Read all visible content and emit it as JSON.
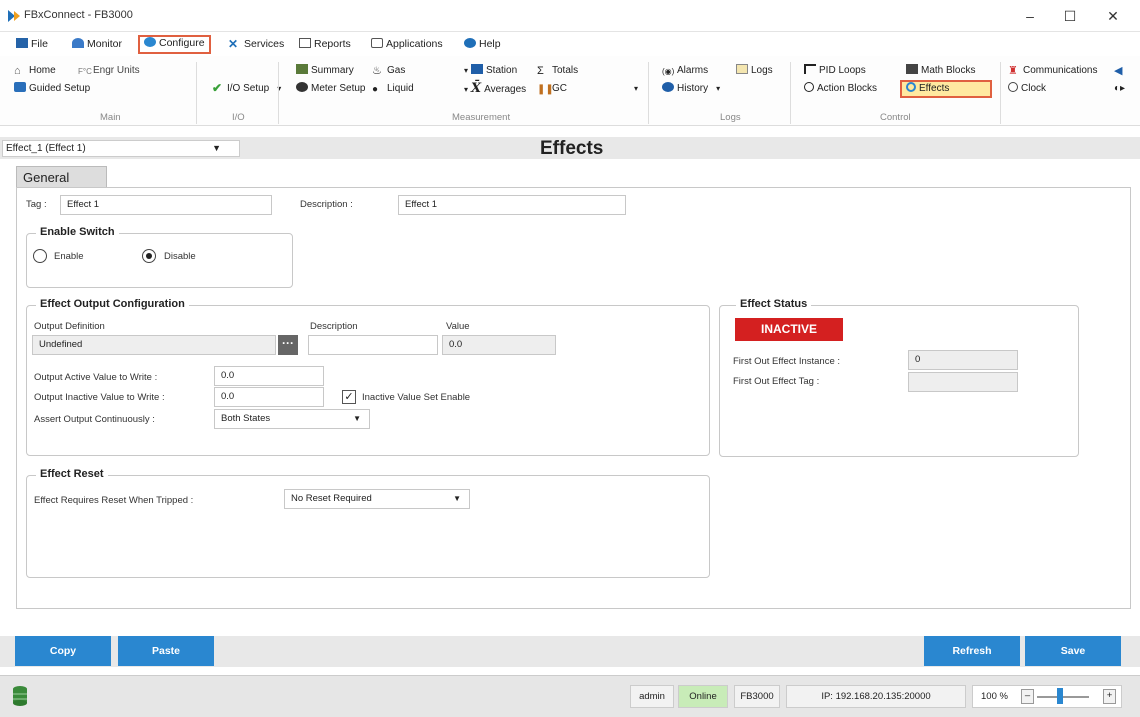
{
  "window": {
    "title": "FBxConnect - FB3000",
    "minimize": "–",
    "maximize": "☐",
    "close": "✕"
  },
  "menu": {
    "items": [
      {
        "label": "File"
      },
      {
        "label": "Monitor"
      },
      {
        "label": "Configure"
      },
      {
        "label": "Services"
      },
      {
        "label": "Reports"
      },
      {
        "label": "Applications"
      },
      {
        "label": "Help"
      }
    ]
  },
  "ribbon": {
    "home": "Home",
    "engr_units": "Engr Units",
    "guided_setup": "Guided Setup",
    "io_setup": "I/O Setup",
    "summary": "Summary",
    "meter_setup": "Meter Setup",
    "gas": "Gas",
    "liquid": "Liquid",
    "station": "Station",
    "averages": "Averages",
    "totals": "Totals",
    "gc": "GC",
    "alarms": "Alarms",
    "history": "History",
    "logs": "Logs",
    "pid_loops": "PID Loops",
    "action_blocks": "Action Blocks",
    "math_blocks": "Math Blocks",
    "effects": "Effects",
    "communications": "Communications",
    "clock": "Clock",
    "groups": {
      "main": "Main",
      "io": "I/O",
      "measurement": "Measurement",
      "logs": "Logs",
      "control": "Control"
    }
  },
  "selector": {
    "value": "Effect_1 (Effect 1)"
  },
  "page_title": "Effects",
  "tab": {
    "label": "General"
  },
  "general": {
    "tag_label": "Tag :",
    "tag_value": "Effect 1",
    "description_label": "Description :",
    "description_value": "Effect 1"
  },
  "enable_switch": {
    "legend": "Enable Switch",
    "enable": "Enable",
    "disable": "Disable",
    "selected": "Disable"
  },
  "output_config": {
    "legend": "Effect Output Configuration",
    "col_definition": "Output Definition",
    "col_description": "Description",
    "col_value": "Value",
    "definition_value": "Undefined",
    "dots": "···",
    "description_value": "",
    "value_value": "0.0",
    "active_label": "Output Active Value to Write :",
    "active_value": "0.0",
    "inactive_label": "Output Inactive Value to Write :",
    "inactive_value": "0.0",
    "inactive_set_label": "Inactive Value Set Enable",
    "inactive_set_checked": "✓",
    "assert_label": "Assert Output Continuously :",
    "assert_value": "Both States"
  },
  "effect_status": {
    "legend": "Effect Status",
    "state": "INACTIVE",
    "state_color": "#d42020",
    "instance_label": "First Out Effect Instance :",
    "instance_value": "0",
    "tag_label": "First Out Effect Tag :",
    "tag_value": ""
  },
  "effect_reset": {
    "legend": "Effect Reset",
    "label": "Effect Requires Reset When Tripped :",
    "value": "No Reset Required"
  },
  "buttons": {
    "copy": "Copy",
    "paste": "Paste",
    "refresh": "Refresh",
    "save": "Save"
  },
  "status": {
    "user": "admin",
    "connection": "Online",
    "device": "FB3000",
    "ip": "IP: 192.168.20.135:20000",
    "zoom": "100 %",
    "zoom_minus": "–",
    "zoom_plus": "+"
  },
  "colors": {
    "accent_blue": "#2a87d0",
    "highlight_red": "#e06040",
    "online_green": "#c8ecb8"
  }
}
